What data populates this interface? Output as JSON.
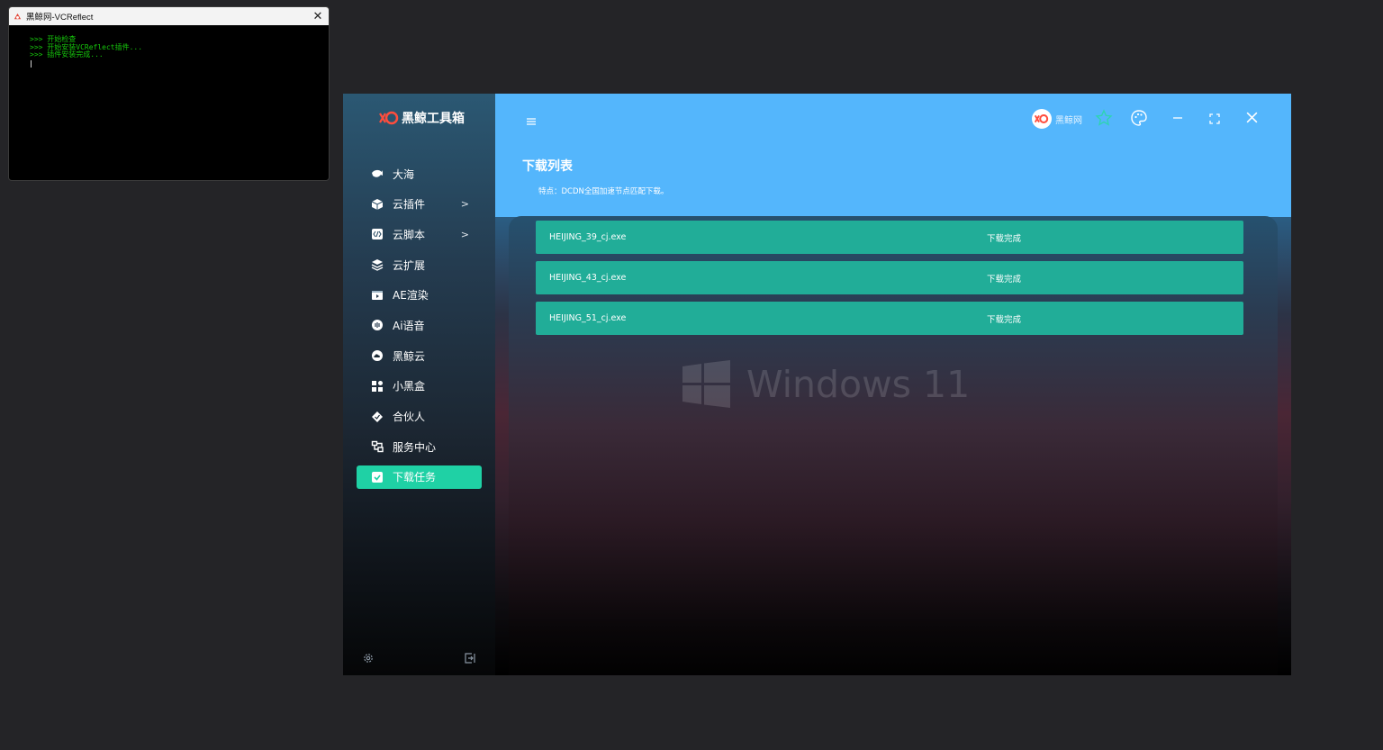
{
  "console": {
    "title": "黑鲸网-VCReflect",
    "lines": [
      ">>> 开始检查",
      ">>> 开始安装VCReflect插件...",
      ">>> 插件安装完成..."
    ]
  },
  "app": {
    "logo_text": "黑鲸工具箱",
    "brand_text": "黑鲸网",
    "page_title": "下载列表",
    "page_note": "特点：DCDN全国加速节点匹配下载。",
    "nav": [
      {
        "label": "大海",
        "icon": "fish-icon"
      },
      {
        "label": "云插件",
        "icon": "cube-icon",
        "has_submenu": true
      },
      {
        "label": "云脚本",
        "icon": "code-icon",
        "has_submenu": true
      },
      {
        "label": "云扩展",
        "icon": "layers-icon"
      },
      {
        "label": "AE渲染",
        "icon": "video-icon"
      },
      {
        "label": "Ai语音",
        "icon": "audio-icon"
      },
      {
        "label": "黑鲸云",
        "icon": "cloud-icon"
      },
      {
        "label": "小黑盒",
        "icon": "grid-icon"
      },
      {
        "label": "合伙人",
        "icon": "diamond-icon"
      },
      {
        "label": "服务中心",
        "icon": "service-icon"
      },
      {
        "label": "下载任务",
        "icon": "download-icon",
        "active": true
      }
    ],
    "downloads": [
      {
        "file": "HEIJING_39_cj.exe",
        "status": "下载完成"
      },
      {
        "file": "HEIJING_43_cj.exe",
        "status": "下载完成"
      },
      {
        "file": "HEIJING_51_cj.exe",
        "status": "下载完成"
      }
    ],
    "wallpaper_text": "Windows 11",
    "colors": {
      "accent": "#1fd1a5",
      "header": "#54b6fc",
      "row": "#21ad98"
    }
  }
}
